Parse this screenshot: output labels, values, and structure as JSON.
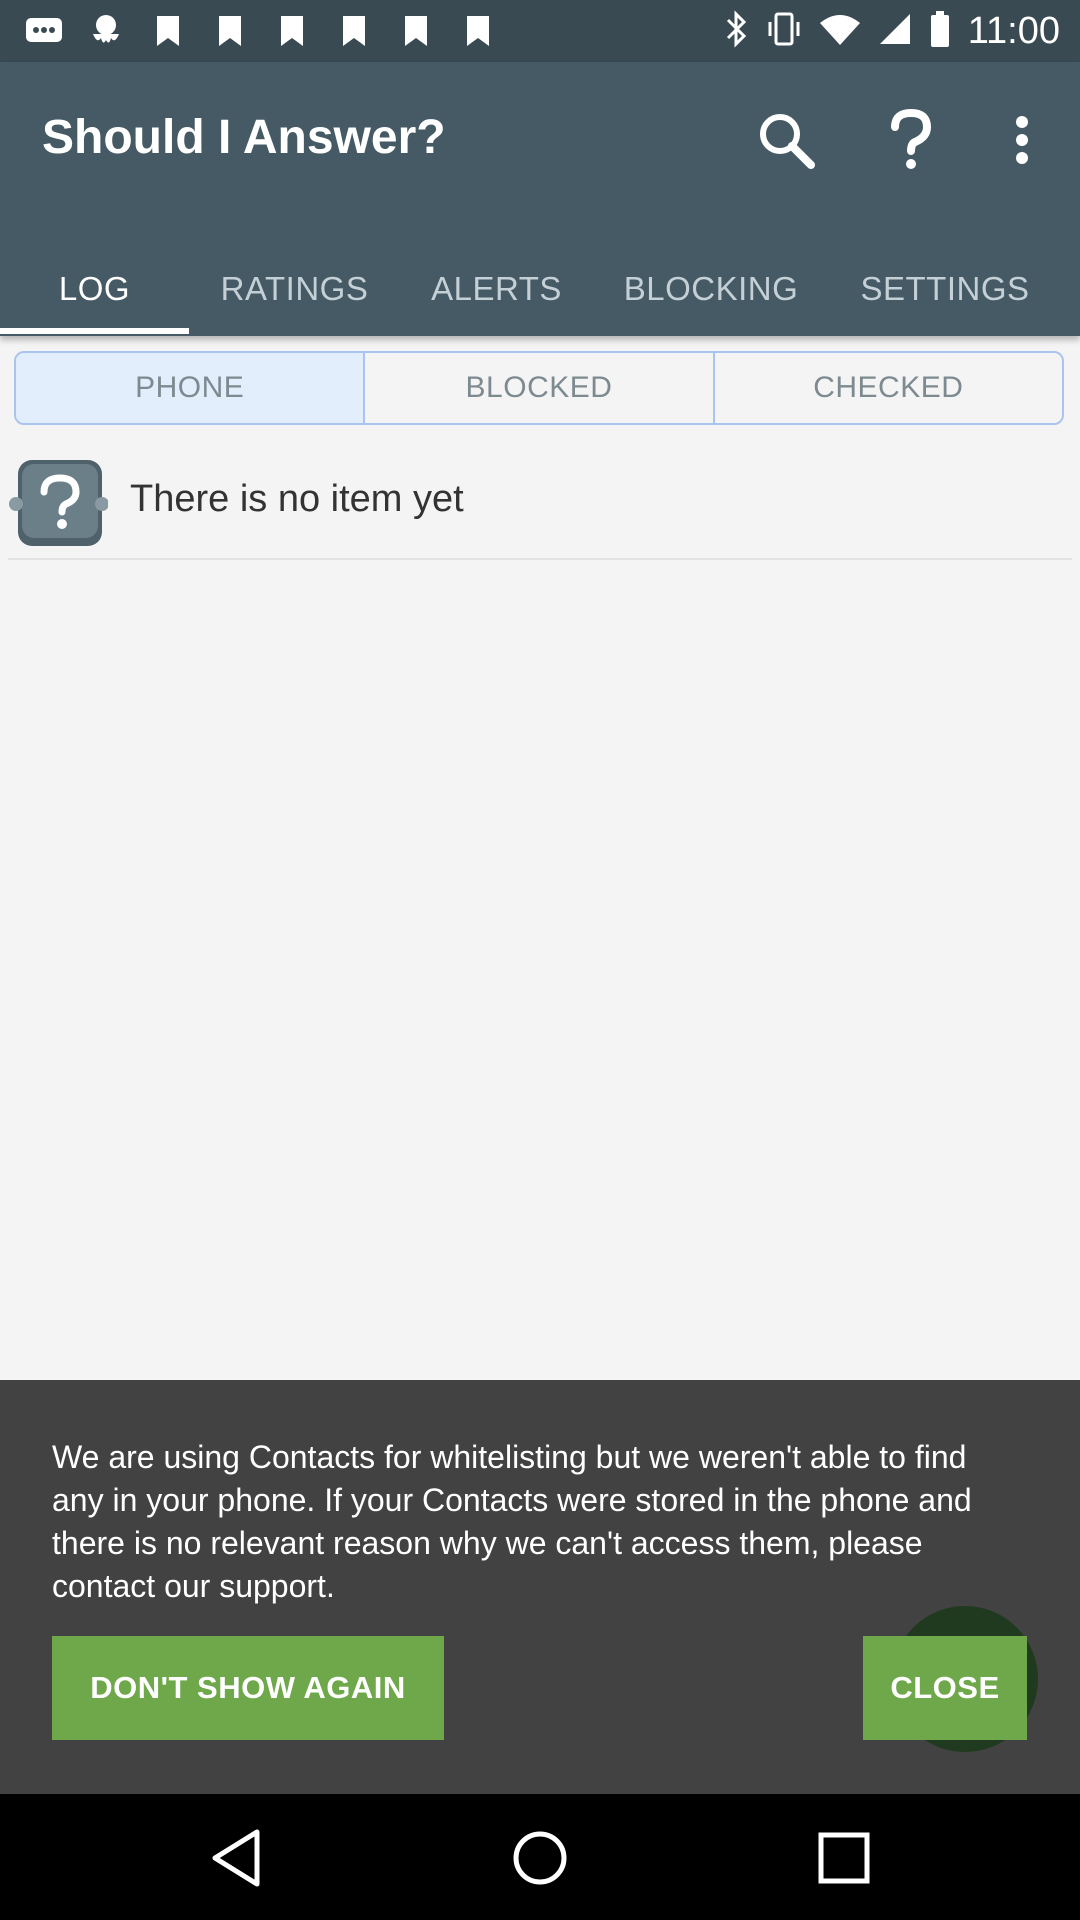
{
  "status_bar": {
    "time": "11:00",
    "left_icons": [
      "message-icon",
      "octopus-icon",
      "bookmark-icon",
      "bookmark-icon",
      "bookmark-icon",
      "bookmark-icon",
      "bookmark-icon",
      "bookmark-icon"
    ],
    "right_icons": [
      "bluetooth-icon",
      "vibrate-icon",
      "wifi-icon",
      "signal-icon",
      "battery-icon"
    ]
  },
  "app_bar": {
    "title": "Should I Answer?",
    "actions": [
      "search-icon",
      "help-icon",
      "more-vert-icon"
    ]
  },
  "tabs": [
    {
      "label": "LOG",
      "active": true
    },
    {
      "label": "RATINGS",
      "active": false
    },
    {
      "label": "ALERTS",
      "active": false
    },
    {
      "label": "BLOCKING",
      "active": false
    },
    {
      "label": "SETTINGS",
      "active": false
    }
  ],
  "segments": [
    {
      "label": "PHONE",
      "active": true
    },
    {
      "label": "BLOCKED",
      "active": false
    },
    {
      "label": "CHECKED",
      "active": false
    }
  ],
  "empty_row": {
    "message": "There is no item yet",
    "icon": "question-app-icon"
  },
  "snackbar": {
    "message": "We are using Contacts for whitelisting but we weren't able to find any in your phone. If your Contacts were stored in the phone and there is no relevant reason why we can't access them, please contact our support.",
    "dont_show_label": "DON'T SHOW AGAIN",
    "close_label": "CLOSE"
  },
  "nav_bar": {
    "buttons": [
      "back-icon",
      "home-icon",
      "recents-icon"
    ]
  },
  "colors": {
    "app_bar": "#455a64",
    "status_bar": "#3a4a52",
    "accent_button": "#6ea84a",
    "snackbar": "#424242",
    "segment_border": "#a9c4ee"
  }
}
